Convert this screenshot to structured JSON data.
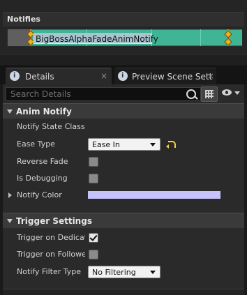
{
  "notifies": {
    "title": "Notifies",
    "notify_name": "BigBossAlphaFadeAnimNotify",
    "track_color": "#3fb595"
  },
  "tabs": [
    {
      "label": "Details",
      "close": "×",
      "icon": "info-icon",
      "active": true
    },
    {
      "label": "Preview Scene Sett",
      "close": "×",
      "icon": "info-icon",
      "active": false
    }
  ],
  "search": {
    "placeholder": "Search Details",
    "value": ""
  },
  "categories": {
    "anim_notify": {
      "title": "Anim Notify",
      "rows": {
        "notify_state_class": {
          "label": "Notify State Class"
        },
        "ease_type": {
          "label": "Ease Type",
          "value": "Ease In"
        },
        "reverse_fade": {
          "label": "Reverse Fade",
          "checked": false
        },
        "is_debugging": {
          "label": "Is Debugging",
          "checked": false
        },
        "notify_color": {
          "label": "Notify Color",
          "color": "#c6c3fb"
        }
      }
    },
    "trigger_settings": {
      "title": "Trigger Settings",
      "rows": {
        "trigger_on_dedicated": {
          "label": "Trigger on Dedicate",
          "checked": true
        },
        "trigger_on_follower": {
          "label": "Trigger on Follower",
          "checked": false
        },
        "notify_filter_type": {
          "label": "Notify Filter Type",
          "value": "No Filtering"
        }
      }
    }
  },
  "colors": {
    "accent": "#3fb595",
    "marker": "#f0b020",
    "reset_arrow": "#f2d23a"
  }
}
